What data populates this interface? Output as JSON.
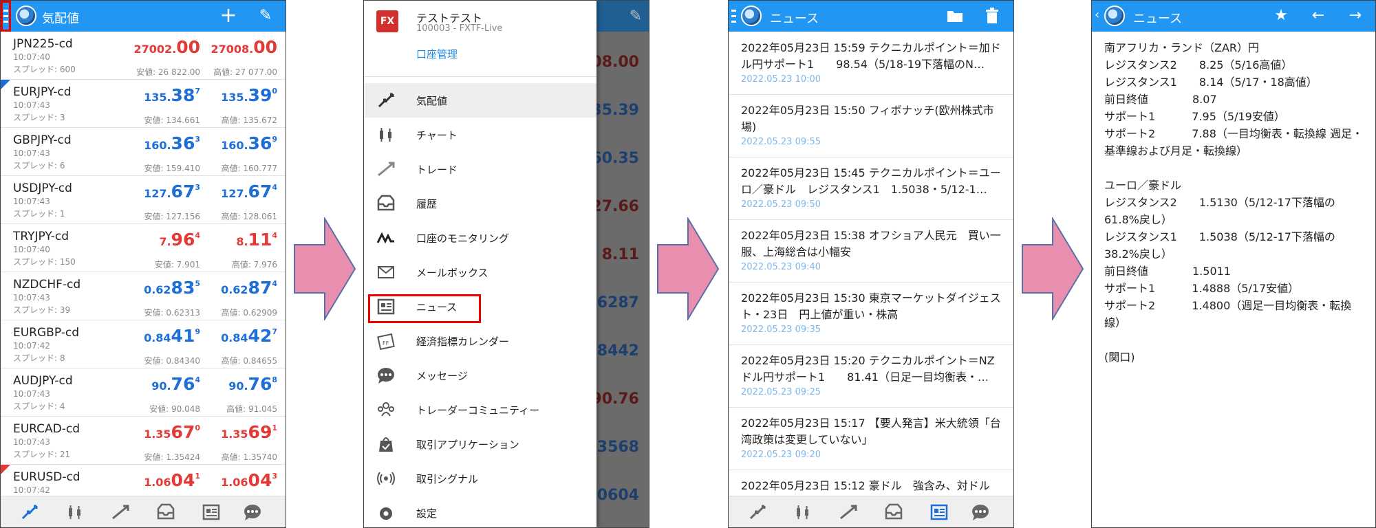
{
  "screen1": {
    "title": "気配値",
    "rows": [
      {
        "symbol": "JPN225-cd",
        "time": "10:07:40",
        "spread": "スプレッド: 600",
        "bid_a": "27002.",
        "bid_b": "00",
        "bid_c": "",
        "ask_a": "27008.",
        "ask_b": "00",
        "ask_c": "",
        "low": "安値: 26 822.00",
        "high": "高値: 27 077.00",
        "color": "red"
      },
      {
        "symbol": "EURJPY-cd",
        "time": "10:07:43",
        "spread": "スプレッド: 3",
        "bid_a": "135.",
        "bid_b": "38",
        "bid_c": "7",
        "ask_a": "135.",
        "ask_b": "39",
        "ask_c": "0",
        "low": "安値: 134.661",
        "high": "高値: 135.672",
        "color": "blue"
      },
      {
        "symbol": "GBPJPY-cd",
        "time": "10:07:43",
        "spread": "スプレッド: 6",
        "bid_a": "160.",
        "bid_b": "36",
        "bid_c": "3",
        "ask_a": "160.",
        "ask_b": "36",
        "ask_c": "9",
        "low": "安値: 159.410",
        "high": "高値: 160.777",
        "color": "blue"
      },
      {
        "symbol": "USDJPY-cd",
        "time": "10:07:43",
        "spread": "スプレッド: 1",
        "bid_a": "127.",
        "bid_b": "67",
        "bid_c": "3",
        "ask_a": "127.",
        "ask_b": "67",
        "ask_c": "4",
        "low": "安値: 127.156",
        "high": "高値: 128.061",
        "color": "blue"
      },
      {
        "symbol": "TRYJPY-cd",
        "time": "10:07:40",
        "spread": "スプレッド: 150",
        "bid_a": "7.",
        "bid_b": "96",
        "bid_c": "4",
        "ask_a": "8.",
        "ask_b": "11",
        "ask_c": "4",
        "low": "安値: 7.901",
        "high": "高値: 7.976",
        "color": "red"
      },
      {
        "symbol": "NZDCHF-cd",
        "time": "10:07:43",
        "spread": "スプレッド: 39",
        "bid_a": "0.62",
        "bid_b": "83",
        "bid_c": "5",
        "ask_a": "0.62",
        "ask_b": "87",
        "ask_c": "4",
        "low": "安値: 0.62313",
        "high": "高値: 0.62909",
        "color": "blue"
      },
      {
        "symbol": "EURGBP-cd",
        "time": "10:07:42",
        "spread": "スプレッド: 8",
        "bid_a": "0.84",
        "bid_b": "41",
        "bid_c": "9",
        "ask_a": "0.84",
        "ask_b": "42",
        "ask_c": "7",
        "low": "安値: 0.84340",
        "high": "高値: 0.84655",
        "color": "blue"
      },
      {
        "symbol": "AUDJPY-cd",
        "time": "10:07:43",
        "spread": "スプレッド: 4",
        "bid_a": "90.",
        "bid_b": "76",
        "bid_c": "4",
        "ask_a": "90.",
        "ask_b": "76",
        "ask_c": "8",
        "low": "安値: 90.048",
        "high": "高値: 91.045",
        "color": "blue"
      },
      {
        "symbol": "EURCAD-cd",
        "time": "10:07:43",
        "spread": "スプレッド: 21",
        "bid_a": "1.35",
        "bid_b": "67",
        "bid_c": "0",
        "ask_a": "1.35",
        "ask_b": "69",
        "ask_c": "1",
        "low": "安値: 1.35424",
        "high": "高値: 1.35740",
        "color": "red"
      },
      {
        "symbol": "EURUSD-cd",
        "time": "10:07:42",
        "spread": "",
        "bid_a": "1.06",
        "bid_b": "04",
        "bid_c": "1",
        "ask_a": "1.06",
        "ask_b": "04",
        "ask_c": "3",
        "low": "",
        "high": "",
        "color": "red"
      }
    ]
  },
  "screen2": {
    "account_name": "テストテスト",
    "account_sub": "100003 - FXTF-Live",
    "account_link": "口座管理",
    "menu": [
      "気配値",
      "チャート",
      "トレード",
      "履歴",
      "口座のモニタリング",
      "メールボックス",
      "ニュース",
      "経済指標カレンダー",
      "メッセージ",
      "トレーダーコミュニティー",
      "取引アプリケーション",
      "取引シグナル",
      "設定"
    ],
    "selected": "気配値",
    "highlighted": "ニュース"
  },
  "screen3": {
    "title": "ニュース",
    "items": [
      {
        "title": "2022年05月23日 15:59 テクニカルポイント＝加ドル円サポート1　　98.54（5/18-19下落幅のN…",
        "date": "2022.05.23 10:00"
      },
      {
        "title": "2022年05月23日 15:50 フィボナッチ(欧州株式市場)",
        "date": "2022.05.23 09:55"
      },
      {
        "title": "2022年05月23日 15:45 テクニカルポイント＝ユーロ／豪ドル　レジスタンス1　1.5038・5/12-1…",
        "date": "2022.05.23 09:50"
      },
      {
        "title": "2022年05月23日 15:38 オフショア人民元　買い一服、上海総合は小幅安",
        "date": "2022.05.23 09:40"
      },
      {
        "title": "2022年05月23日 15:30 東京マーケットダイジェスト・23日　円上値が重い・株高",
        "date": "2022.05.23 09:35"
      },
      {
        "title": "2022年05月23日 15:20 テクニカルポイント＝NZドル円サポート1　　81.41（日足一目均衡表・…",
        "date": "2022.05.23 09:25"
      },
      {
        "title": "2022年05月23日 15:17 【要人発言】米大統領「台湾政策は変更していない」",
        "date": "2022.05.23 09:20"
      },
      {
        "title": "2022年05月23日 15:12 豪ドル　強含み、対ドル",
        "date": ""
      }
    ]
  },
  "screen4": {
    "title": "ニュース",
    "body": "南アフリカ・ランド（ZAR）円\nレジスタンス2　　8.25（5/16高値）\nレジスタンス1　　8.14（5/17・18高値）\n前日終値　　　　8.07\nサポート1　　　 7.95（5/19安値）\nサポート2　　　 7.88（一目均衡表・転換線 週足・基準線および月足・転換線）\n\nユーロ／豪ドル\nレジスタンス2　　1.5130（5/12-17下落幅の61.8%戻し）\nレジスタンス1　　1.5038（5/12-17下落幅の38.2%戻し）\n前日終値　　　　1.5011\nサポート1　　　 1.4888（5/17安値）\nサポート2　　　 1.4800（週足一目均衡表・転換線）\n\n(関口)"
  },
  "colors": {
    "topbar": "#2196f3",
    "bid_blue": "#1e6ed8",
    "bid_red": "#e53935",
    "arrow": "#e88fb0",
    "highlight": "#ee0000"
  }
}
